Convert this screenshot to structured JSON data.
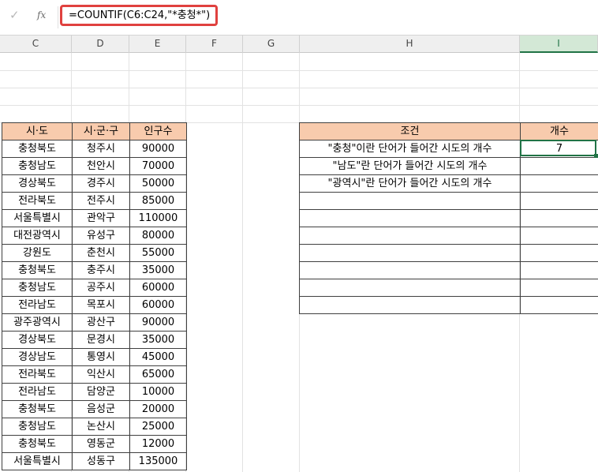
{
  "formula_bar": {
    "enter_icon": "✓",
    "fx_label": "fx",
    "formula": "=COUNTIF(C6:C24,\"*충청*\")"
  },
  "columns": [
    "C",
    "D",
    "E",
    "F",
    "G",
    "H",
    "I"
  ],
  "active_column": "I",
  "left_table": {
    "headers": [
      "시·도",
      "시·군·구",
      "인구수"
    ],
    "rows": [
      [
        "충청북도",
        "청주시",
        "90000"
      ],
      [
        "충청남도",
        "천안시",
        "70000"
      ],
      [
        "경상북도",
        "경주시",
        "50000"
      ],
      [
        "전라북도",
        "전주시",
        "85000"
      ],
      [
        "서울특별시",
        "관악구",
        "110000"
      ],
      [
        "대전광역시",
        "유성구",
        "80000"
      ],
      [
        "강원도",
        "춘천시",
        "55000"
      ],
      [
        "충청북도",
        "충주시",
        "35000"
      ],
      [
        "충청남도",
        "공주시",
        "60000"
      ],
      [
        "전라남도",
        "목포시",
        "60000"
      ],
      [
        "광주광역시",
        "광산구",
        "90000"
      ],
      [
        "경상북도",
        "문경시",
        "35000"
      ],
      [
        "경상남도",
        "통영시",
        "45000"
      ],
      [
        "전라북도",
        "익산시",
        "65000"
      ],
      [
        "전라남도",
        "담양군",
        "10000"
      ],
      [
        "충청북도",
        "음성군",
        "20000"
      ],
      [
        "충청남도",
        "논산시",
        "25000"
      ],
      [
        "충청북도",
        "영동군",
        "12000"
      ],
      [
        "서울특별시",
        "성동구",
        "135000"
      ]
    ]
  },
  "right_table": {
    "headers": [
      "조건",
      "개수"
    ],
    "rows": [
      [
        "\"충청\"이란 단어가 들어간 시도의 개수",
        "7"
      ],
      [
        "\"남도\"란 단어가 들어간 시도의 개수",
        ""
      ],
      [
        "\"광역시\"란 단어가 들어간 시도의 개수",
        ""
      ],
      [
        "",
        ""
      ],
      [
        "",
        ""
      ],
      [
        "",
        ""
      ],
      [
        "",
        ""
      ],
      [
        "",
        ""
      ],
      [
        "",
        ""
      ],
      [
        "",
        ""
      ]
    ]
  },
  "colors": {
    "header_fill": "#f8cbad",
    "selection": "#217346",
    "formula_highlight": "#e0413f"
  }
}
